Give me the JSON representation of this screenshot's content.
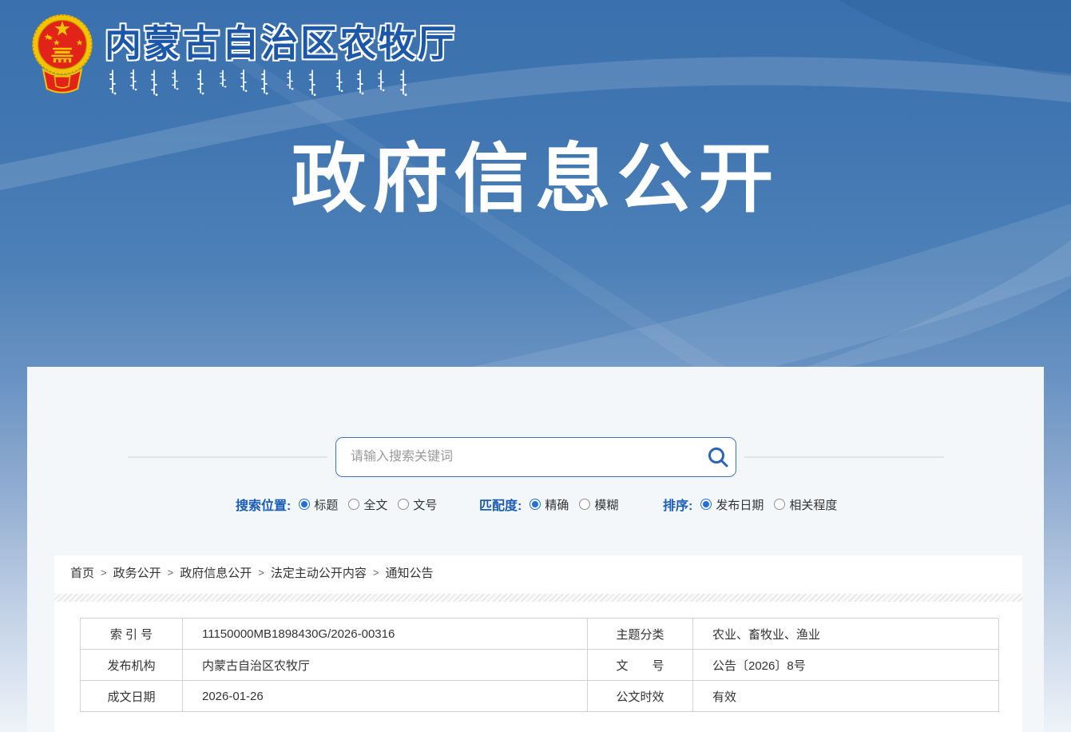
{
  "header": {
    "agency_name": "内蒙古自治区农牧厅",
    "page_title": "政府信息公开"
  },
  "search": {
    "placeholder": "请输入搜索关键词",
    "icon": "search-icon"
  },
  "filters": {
    "groups": [
      {
        "label": "搜索位置:",
        "options": [
          {
            "label": "标题",
            "checked": true
          },
          {
            "label": "全文",
            "checked": false
          },
          {
            "label": "文号",
            "checked": false
          }
        ]
      },
      {
        "label": "匹配度:",
        "options": [
          {
            "label": "精确",
            "checked": true
          },
          {
            "label": "模糊",
            "checked": false
          }
        ]
      },
      {
        "label": "排序:",
        "options": [
          {
            "label": "发布日期",
            "checked": true
          },
          {
            "label": "相关程度",
            "checked": false
          }
        ]
      }
    ]
  },
  "breadcrumb": {
    "separator": ">",
    "items": [
      "首页",
      "政务公开",
      "政府信息公开",
      "法定主动公开内容",
      "通知公告"
    ]
  },
  "doc_info": {
    "rows": [
      {
        "label": "索 引 号",
        "value": "11150000MB1898430G/2026-00316",
        "label2": "主题分类",
        "value2": "农业、畜牧业、渔业"
      },
      {
        "label": "发布机构",
        "value": "内蒙古自治区农牧厅",
        "label2": "文　　号",
        "value2": "公告〔2026〕8号"
      },
      {
        "label": "成文日期",
        "value": "2026-01-26",
        "label2": "公文时效",
        "value2": "有效"
      }
    ]
  },
  "colors": {
    "header_blue_top": "#3a70ad",
    "accent_label_blue": "#1b5cb4",
    "agency_title_blue": "#1d57a8",
    "search_border_blue": "#3d76c8",
    "radio_checked_blue": "#2270d8",
    "emblem_red": "#e2231a",
    "emblem_gold": "#f5c400",
    "panel_bg": "#f3f7fa",
    "text_dark": "#333333"
  }
}
